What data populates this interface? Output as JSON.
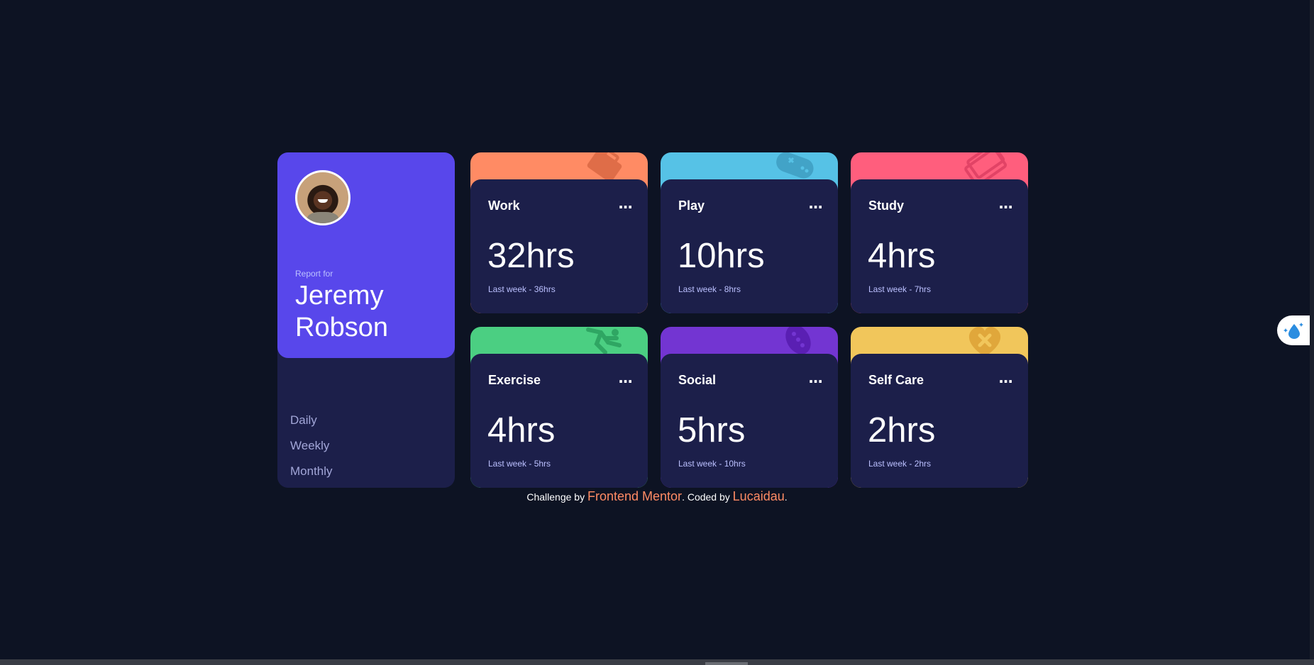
{
  "profile": {
    "report_for": "Report for",
    "name": "Jeremy Robson",
    "periods": [
      "Daily",
      "Weekly",
      "Monthly"
    ]
  },
  "cards": [
    {
      "title": "Work",
      "current": "32hrs",
      "previous": "Last week - 36hrs",
      "color": "#ff8b64",
      "icon": "briefcase-icon",
      "menu": "..."
    },
    {
      "title": "Play",
      "current": "10hrs",
      "previous": "Last week - 8hrs",
      "color": "#56c2e6",
      "icon": "gamepad-icon",
      "menu": "..."
    },
    {
      "title": "Study",
      "current": "4hrs",
      "previous": "Last week - 7hrs",
      "color": "#ff5e7d",
      "icon": "book-icon",
      "menu": "..."
    },
    {
      "title": "Exercise",
      "current": "4hrs",
      "previous": "Last week - 5hrs",
      "color": "#4bcf82",
      "icon": "running-icon",
      "menu": "..."
    },
    {
      "title": "Social",
      "current": "5hrs",
      "previous": "Last week - 10hrs",
      "color": "#7335d2",
      "icon": "chat-icon",
      "menu": "..."
    },
    {
      "title": "Self Care",
      "current": "2hrs",
      "previous": "Last week - 2hrs",
      "color": "#f1c65b",
      "icon": "heart-icon",
      "menu": "..."
    }
  ],
  "footer": {
    "prefix": "Challenge by",
    "link1": "Frontend Mentor",
    "middle": ". Coded by",
    "link2": "Lucaidau",
    "suffix": "."
  },
  "colors": {
    "background": "#0d1323",
    "card_bg": "#1c1f4a",
    "profile_accent": "#5847eb",
    "link": "#ff8b64"
  }
}
